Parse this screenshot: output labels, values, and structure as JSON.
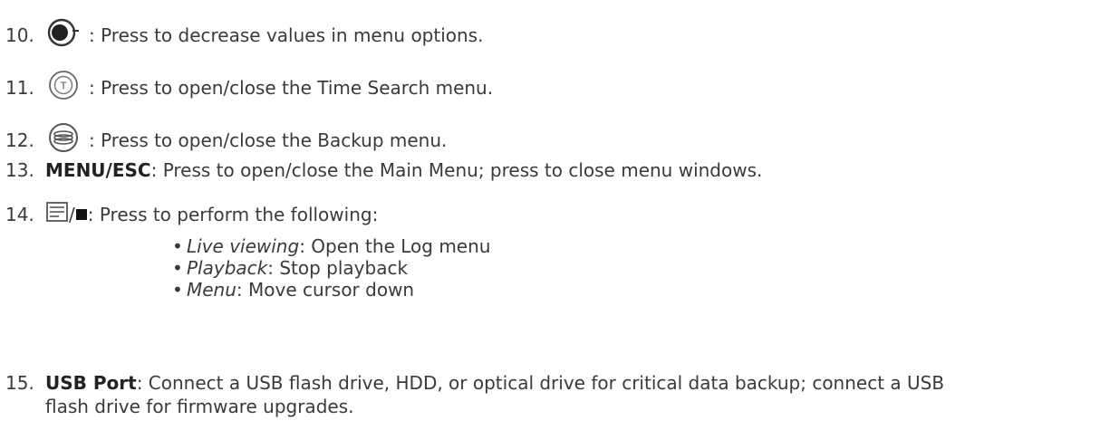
{
  "items": [
    {
      "number": "10.",
      "icon": "decrease-button-icon",
      "text": ": Press to decrease values in menu options."
    },
    {
      "number": "11.",
      "icon": "time-search-button-icon",
      "text": ": Press to open/close the Time Search menu."
    },
    {
      "number": "12.",
      "icon": "backup-button-icon",
      "text": ": Press to open/close the Backup menu."
    },
    {
      "number": "13.",
      "bold": "MENU/ESC",
      "text": ": Press to open/close the Main Menu; press to close menu windows."
    },
    {
      "number": "14.",
      "icon": "log-stop-button-icon",
      "separator": "/",
      "text": ": Press to perform the following:",
      "bullets": [
        {
          "term": "Live viewing",
          "desc": ": Open the Log menu"
        },
        {
          "term": "Playback",
          "desc": ": Stop playback"
        },
        {
          "term": "Menu",
          "desc": ": Move cursor down"
        }
      ]
    },
    {
      "number": "15.",
      "bold": "USB Port",
      "text": ": Connect a USB flash drive, HDD, or optical drive for critical data backup; connect a USB",
      "text_line2": "flash drive for firmware upgrades."
    }
  ]
}
